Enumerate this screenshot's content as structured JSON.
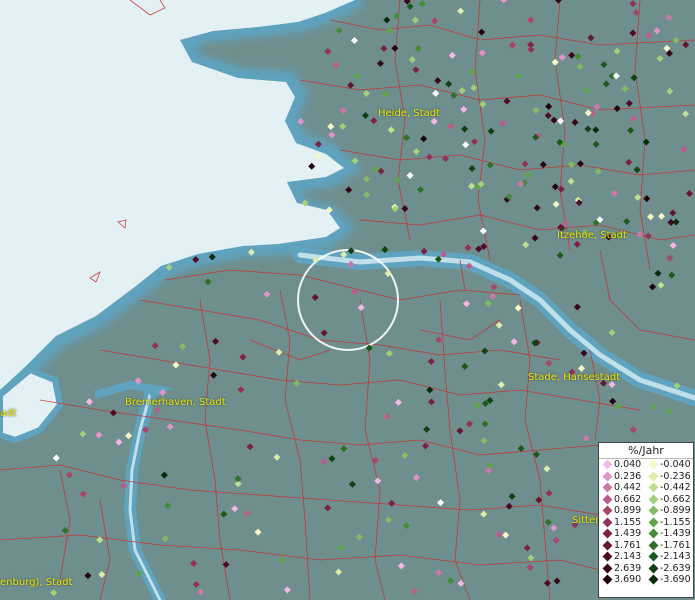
{
  "map": {
    "colors": {
      "land": "#6f8f8f",
      "sea": "#dfeef2",
      "coast": "#5fa3bf",
      "borders": "#c8322f",
      "search_circle": "#ffffff"
    }
  },
  "towns": [
    {
      "id": "heide",
      "label": "Heide, Stadt"
    },
    {
      "id": "itzehoe",
      "label": "Itzehoe, Stadt"
    },
    {
      "id": "stade",
      "label": "Stade, Hansestadt"
    },
    {
      "id": "bremerhaven",
      "label": "Bremerhaven, Stadt"
    },
    {
      "id": "sitten",
      "label": "Sitten"
    },
    {
      "id": "enburg",
      "label": "enburg), Stadt"
    },
    {
      "id": "edge",
      "label": "adt"
    }
  ],
  "legend": {
    "title": "%/Jahr",
    "positive": [
      {
        "value": "0.040",
        "color": "#f4b8e6"
      },
      {
        "value": "0.236",
        "color": "#e294c8"
      },
      {
        "value": "0.442",
        "color": "#cf77a8"
      },
      {
        "value": "0.662",
        "color": "#bb5c8a"
      },
      {
        "value": "0.899",
        "color": "#a8456f"
      },
      {
        "value": "1.155",
        "color": "#923258"
      },
      {
        "value": "1.439",
        "color": "#7c2244"
      },
      {
        "value": "1.761",
        "color": "#651633"
      },
      {
        "value": "2.143",
        "color": "#4e0c24"
      },
      {
        "value": "2.639",
        "color": "#380617"
      },
      {
        "value": "3.690",
        "color": "#23020c"
      }
    ],
    "negative": [
      {
        "value": "-0.040",
        "color": "#f6f8c6"
      },
      {
        "value": "-0.236",
        "color": "#dcedaa"
      },
      {
        "value": "-0.442",
        "color": "#bfe08e"
      },
      {
        "value": "-0.662",
        "color": "#a0d07a"
      },
      {
        "value": "-0.899",
        "color": "#80bd62"
      },
      {
        "value": "-1.155",
        "color": "#5fa64a"
      },
      {
        "value": "-1.439",
        "color": "#448c37"
      },
      {
        "value": "-1.761",
        "color": "#2d7227"
      },
      {
        "value": "-2.143",
        "color": "#1b5a1a"
      },
      {
        "value": "-2.639",
        "color": "#0e4210"
      },
      {
        "value": "-3.690",
        "color": "#052b08"
      }
    ]
  }
}
